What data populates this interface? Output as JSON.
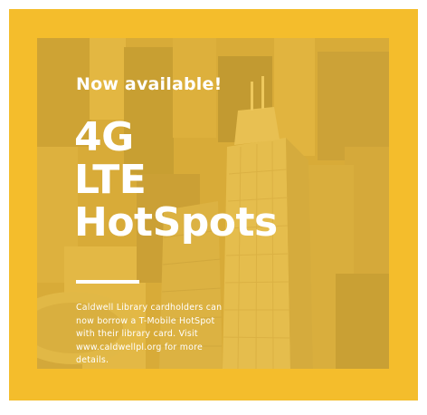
{
  "colors": {
    "frame": "#f4bd2c",
    "tint": "#ecba34",
    "text": "#ffffff"
  },
  "kicker": "Now available!",
  "headline": {
    "line1": "4G",
    "line2": "LTE",
    "line3": "HotSpots"
  },
  "body": {
    "line1": "Caldwell Library cardholders can",
    "line2": "now borrow a T-Mobile HotSpot",
    "line3": "with their library card. Visit",
    "line4": "www.caldwellpl.org for more",
    "line5": "details."
  }
}
